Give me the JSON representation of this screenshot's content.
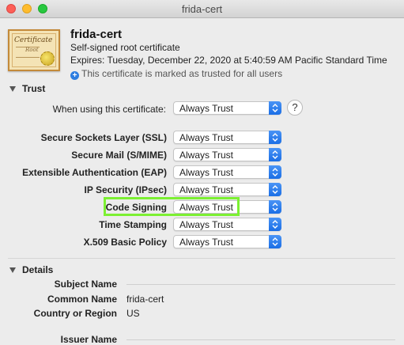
{
  "window": {
    "title": "frida-cert"
  },
  "header": {
    "icon_text": "Certificate",
    "icon_sub": "Root",
    "name": "frida-cert",
    "subtitle": "Self-signed root certificate",
    "expires": "Expires: Tuesday, December 22, 2020 at 5:40:59 AM Pacific Standard Time",
    "trusted_note": "This certificate is marked as trusted for all users"
  },
  "trust": {
    "section_label": "Trust",
    "when_using_label": "When using this certificate:",
    "when_using_value": "Always Trust",
    "help_label": "?",
    "rows": [
      {
        "label": "Secure Sockets Layer (SSL)",
        "value": "Always Trust"
      },
      {
        "label": "Secure Mail (S/MIME)",
        "value": "Always Trust"
      },
      {
        "label": "Extensible Authentication (EAP)",
        "value": "Always Trust"
      },
      {
        "label": "IP Security (IPsec)",
        "value": "Always Trust"
      },
      {
        "label": "Code Signing",
        "value": "Always Trust"
      },
      {
        "label": "Time Stamping",
        "value": "Always Trust"
      },
      {
        "label": "X.509 Basic Policy",
        "value": "Always Trust"
      }
    ],
    "highlight_color": "#7cf032"
  },
  "details": {
    "section_label": "Details",
    "subject_name_label": "Subject Name",
    "common_name_label": "Common Name",
    "common_name_value": "frida-cert",
    "country_label": "Country or Region",
    "country_value": "US",
    "issuer_name_label": "Issuer Name"
  }
}
